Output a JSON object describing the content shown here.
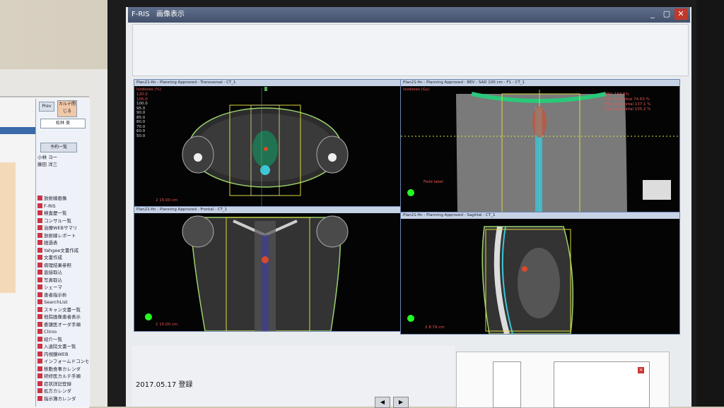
{
  "window": {
    "app_label": "F-RIS",
    "title": "画像表示",
    "close_label": "✕",
    "max_label": "▢",
    "min_label": "_"
  },
  "left_panel": {
    "buttons": [
      "Prev",
      "カルテ閉じる"
    ],
    "patient_label": "松林 美",
    "btn_yoyaku": "予約一覧",
    "list_entries": [
      "小林 ヨー",
      "藤田 洋三"
    ],
    "menu_items": [
      "放射線画像",
      "F-RIS",
      "検査歴一覧",
      "コンサル一覧",
      "治療WEBサマリ",
      "放射線レポート",
      "経過表",
      "Yahgee文書作成",
      "文書作成",
      "病理結果参照",
      "直接取込",
      "写真取込",
      "シェーマ",
      "患者指示析",
      "SearchList",
      "スキャン文書一覧",
      "他院画像患者表示",
      "委譲医オーダ手順",
      "Clinio",
      "紹介一覧",
      "入退院文書一覧",
      "内視鏡WEB",
      "インフォームドコンセント",
      "移動食事カレンダ",
      "研修医カルテ手順",
      "症状詳記登録",
      "処方カレンダ",
      "指示簿カレンダ"
    ]
  },
  "viewports": {
    "transversal": {
      "header": "Plan21-fin - Planning Approved - Transversal - CT_1",
      "iso_label": "Isodoses (%)",
      "iso_values": [
        "120.0",
        "105.0",
        "100.0",
        "95.0",
        "90.0",
        "85.0",
        "80.0",
        "70.0",
        "60.0",
        "50.0"
      ],
      "scale_text": "2  15.00 cm"
    },
    "bev": {
      "header": "Plan21-fin - Planning Approved - BEV - SAD 100 cm - F1 - CT_1",
      "iso_label": "Isodoses (Gy)",
      "legend": [
        "MRC 158.5%",
        "PTV min initial 74.63 %",
        "PTV max initial 137.1 %",
        "PTV max initial 105.2 %"
      ],
      "field_label": "Field label"
    },
    "frontal": {
      "header": "Plan21-fin - Planning Approved - Frontal - CT_1",
      "scale_text": "2  15.00 cm"
    },
    "sagittal": {
      "header": "Plan21-fin - Planning Approved - Sagittal - CT_1",
      "scale_text": "2  8.79 cm"
    }
  },
  "status": {
    "date": "2017.05.17",
    "action": "登録"
  },
  "nav": {
    "prev": "◀",
    "next": "▶"
  },
  "colors": {
    "isodose_green": "#29c97a",
    "ptv_yellow": "#d9d93a",
    "contour_green": "#9ad26b",
    "field_outline": "#e5e08a",
    "crosshair": "#e2e23a",
    "dose_red": "#d94a2a",
    "spine_cyan": "#3cc6d8"
  }
}
